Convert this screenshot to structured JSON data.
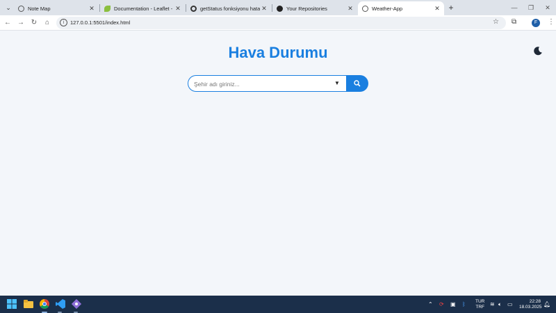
{
  "browser": {
    "tabs": [
      {
        "title": "Note Map",
        "active": false
      },
      {
        "title": "Documentation - Leaflet - a Ja",
        "active": false
      },
      {
        "title": "getStatus fonksiyonu hatası",
        "active": false
      },
      {
        "title": "Your Repositories",
        "active": false
      },
      {
        "title": "Weather-App",
        "active": true
      }
    ],
    "address": "127.0.0.1:5501/index.html",
    "profile_initial": "F"
  },
  "page": {
    "title": "Hava Durumu",
    "search_placeholder": "Şehir adı giriniz...",
    "theme_icon": "moon-icon"
  },
  "taskbar": {
    "apps": [
      "windows-start-icon",
      "file-explorer-icon",
      "chrome-icon",
      "vscode-icon",
      "git-icon"
    ],
    "lang_line1": "TUR",
    "lang_line2": "TRF",
    "time": "22:28",
    "date": "18.03.2025"
  },
  "colors": {
    "accent": "#1a7fe0",
    "page_bg": "#f3f6fa",
    "taskbar_bg": "#1b2f4a"
  }
}
